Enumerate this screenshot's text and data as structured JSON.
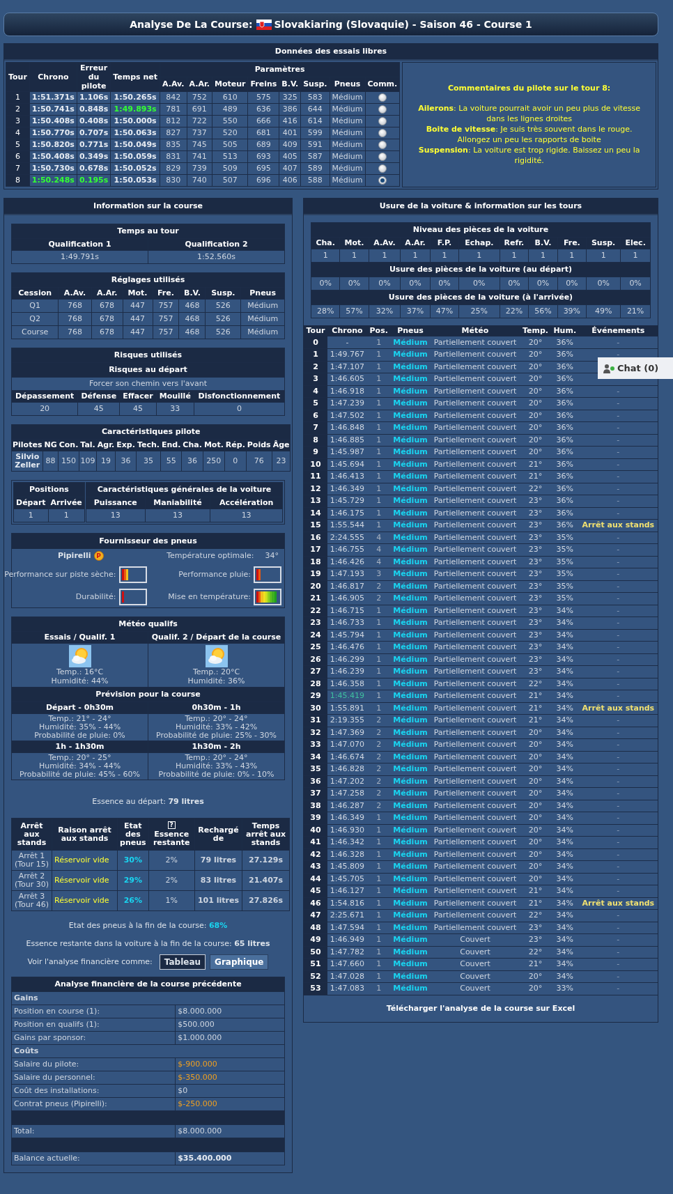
{
  "title": {
    "prefix": "Analyse De La Course:",
    "text": "Slovakiaring (Slovaquie) - Saison 46 - Course 1"
  },
  "chat": {
    "label": "Chat (0)"
  },
  "practice": {
    "title": "Données des essais libres",
    "columns": [
      "Tour",
      "Chrono",
      "Erreur du pilote",
      "Temps net"
    ],
    "params_header": "Paramètres",
    "params": [
      "A.Av.",
      "A.Ar.",
      "Moteur",
      "Freins",
      "B.V.",
      "Susp.",
      "Pneus",
      "Comm."
    ],
    "rows": [
      {
        "cells": [
          "1",
          "1:51.371s",
          "1.106s",
          "1:50.265s",
          "842",
          "752",
          "610",
          "575",
          "325",
          "583",
          "Médium"
        ],
        "chrono_best": false,
        "error_best": false,
        "net_best": false,
        "selected": false
      },
      {
        "cells": [
          "2",
          "1:50.741s",
          "0.848s",
          "1:49.893s",
          "781",
          "691",
          "489",
          "636",
          "386",
          "644",
          "Médium"
        ],
        "chrono_best": false,
        "error_best": false,
        "net_best": true,
        "selected": false
      },
      {
        "cells": [
          "3",
          "1:50.408s",
          "0.408s",
          "1:50.000s",
          "812",
          "722",
          "550",
          "666",
          "416",
          "614",
          "Médium"
        ],
        "chrono_best": false,
        "error_best": false,
        "net_best": false,
        "selected": false
      },
      {
        "cells": [
          "4",
          "1:50.770s",
          "0.707s",
          "1:50.063s",
          "827",
          "737",
          "520",
          "681",
          "401",
          "599",
          "Médium"
        ],
        "chrono_best": false,
        "error_best": false,
        "net_best": false,
        "selected": false
      },
      {
        "cells": [
          "5",
          "1:50.820s",
          "0.771s",
          "1:50.049s",
          "835",
          "745",
          "505",
          "689",
          "409",
          "591",
          "Médium"
        ],
        "chrono_best": false,
        "error_best": false,
        "net_best": false,
        "selected": false
      },
      {
        "cells": [
          "6",
          "1:50.408s",
          "0.349s",
          "1:50.059s",
          "831",
          "741",
          "513",
          "693",
          "405",
          "587",
          "Médium"
        ],
        "chrono_best": false,
        "error_best": false,
        "net_best": false,
        "selected": false
      },
      {
        "cells": [
          "7",
          "1:50.730s",
          "0.678s",
          "1:50.052s",
          "829",
          "739",
          "509",
          "695",
          "407",
          "589",
          "Médium"
        ],
        "chrono_best": false,
        "error_best": false,
        "net_best": false,
        "selected": false
      },
      {
        "cells": [
          "8",
          "1:50.248s",
          "0.195s",
          "1:50.053s",
          "830",
          "740",
          "507",
          "696",
          "406",
          "588",
          "Médium"
        ],
        "chrono_best": true,
        "error_best": true,
        "net_best": false,
        "selected": true
      }
    ],
    "comment": {
      "title": "Commentaires du pilote sur le tour 8:",
      "lines": [
        "**Ailerons**: La voiture pourrait avoir un peu plus de vitesse dans les lignes droites",
        "**Boite de vitesse**: Je suis très souvent dans le rouge. Allongez un peu les rapports de boite",
        "**Suspension**: La voiture est trop rigide. Baissez un peu la rigidité."
      ]
    }
  },
  "info": {
    "title": "Information sur la course",
    "laptimes": {
      "title": "Temps au tour",
      "columns": [
        "Qualification 1",
        "Qualification 2"
      ],
      "values": [
        "1:49.791s",
        "1:52.560s"
      ]
    },
    "setup": {
      "title": "Réglages utilisés",
      "columns": [
        "Cession",
        "A.Av.",
        "A.Ar.",
        "Mot.",
        "Fre.",
        "B.V.",
        "Susp.",
        "Pneus"
      ],
      "rows": [
        [
          "Q1",
          "768",
          "678",
          "447",
          "757",
          "468",
          "526",
          "Médium"
        ],
        [
          "Q2",
          "768",
          "678",
          "447",
          "757",
          "468",
          "526",
          "Médium"
        ],
        [
          "Course",
          "768",
          "678",
          "447",
          "757",
          "468",
          "526",
          "Médium"
        ]
      ]
    },
    "risks": {
      "title": "Risques utilisés",
      "subtitle": "Risques au départ",
      "start": "Forcer son chemin vers l'avant",
      "columns": [
        "Dépassement",
        "Défense",
        "Effacer",
        "Mouillé",
        "Disfonctionnement"
      ],
      "values": [
        "20",
        "45",
        "45",
        "33",
        "0"
      ]
    },
    "driver": {
      "title": "Caractéristiques pilote",
      "columns": [
        "Pilotes",
        "NG",
        "Con.",
        "Tal.",
        "Agr.",
        "Exp.",
        "Tech.",
        "End.",
        "Cha.",
        "Mot.",
        "Rép.",
        "Poids",
        "Âge"
      ],
      "name": "Silvio Zeller",
      "values": [
        "88",
        "150",
        "109",
        "19",
        "36",
        "35",
        "55",
        "36",
        "250",
        "0",
        "76",
        "23"
      ]
    },
    "positions": {
      "title": "Positions",
      "columns": [
        "Départ",
        "Arrivée"
      ],
      "values": [
        "1",
        "1"
      ]
    },
    "car": {
      "title": "Caractéristiques générales de la voiture",
      "columns": [
        "Puissance",
        "Maniabilité",
        "Accélération"
      ],
      "values": [
        "13",
        "13",
        "13"
      ]
    },
    "tyres": {
      "title": "Fournisseur des pneus",
      "name": "Pipirelli",
      "badge": "P",
      "optimal_label": "Température optimale:",
      "optimal_value": "34°",
      "meters": [
        {
          "label": "Performance sur piste sèche:",
          "level": 0.3
        },
        {
          "label": "Performance pluie:",
          "level": 0.2
        },
        {
          "label": "Durabilité:",
          "level": 0.1
        },
        {
          "label": "Mise en température:",
          "level": 0.9
        }
      ]
    },
    "weather": {
      "title": "Météo qualifs",
      "sessions": [
        {
          "title": "Essais / Qualif. 1",
          "temp": "Temp.: 16°C",
          "humidity": "Humidité: 44%"
        },
        {
          "title": "Qualif. 2 / Départ de la course",
          "temp": "Temp.: 20°C",
          "humidity": "Humidité: 36%"
        }
      ],
      "forecast_title": "Prévision pour la course",
      "forecast": [
        {
          "title": "Départ - 0h30m",
          "lines": [
            "Temp.: 21° - 24°",
            "Humidité: 35% - 44%",
            "Probabilité de pluie: 0%"
          ]
        },
        {
          "title": "0h30m - 1h",
          "lines": [
            "Temp.: 20° - 24°",
            "Humidité: 33% - 42%",
            "Probabilité de pluie: 25% - 30%"
          ]
        },
        {
          "title": "1h - 1h30m",
          "lines": [
            "Temp.: 20° - 25°",
            "Humidité: 34% - 44%",
            "Probabilité de pluie: 45% - 60%"
          ]
        },
        {
          "title": "1h30m - 2h",
          "lines": [
            "Temp.: 20° - 24°",
            "Humidité: 33% - 43%",
            "Probabilité de pluie: 0% - 10%"
          ]
        }
      ]
    },
    "fuel_start": "Essence au départ: **79 litres**",
    "pits": {
      "columns": [
        {
          "label": "Arrêt aux stands"
        },
        {
          "label": "Raison arrêt aux stands"
        },
        {
          "label": "Etat des pneus"
        },
        {
          "label": "Essence restante",
          "help": "?"
        },
        {
          "label": "Rechargé de"
        },
        {
          "label": "Temps arrêt aux stands"
        }
      ],
      "rows": [
        [
          "Arrêt 1 (Tour 15)",
          "Réservoir vide",
          "30%",
          "2%",
          "79 litres",
          "27.129s"
        ],
        [
          "Arrêt 2 (Tour 30)",
          "Réservoir vide",
          "29%",
          "2%",
          "83 litres",
          "21.407s"
        ],
        [
          "Arrêt 3 (Tour 46)",
          "Réservoir vide",
          "26%",
          "1%",
          "101 litres",
          "27.826s"
        ]
      ]
    },
    "tyres_end": {
      "label": "Etat des pneus à la fin de la course:",
      "value": "68%"
    },
    "fuel_end": "Essence restante dans la voiture à la fin de la course: **65 litres**",
    "view": {
      "label": "Voir l'analyse financière comme:",
      "options": [
        {
          "label": "Tableau",
          "selected": true
        },
        {
          "label": "Graphique",
          "selected": false
        }
      ]
    },
    "finance": {
      "title": "Analyse financière de la course précédente",
      "rows": [
        {
          "kind": "section",
          "label": "Gains"
        },
        {
          "kind": "item",
          "label": "Position en course (1):",
          "value": "$8.000.000"
        },
        {
          "kind": "item",
          "label": "Position en qualifs (1):",
          "value": "$500.000"
        },
        {
          "kind": "item",
          "label": "Gains par sponsor:",
          "value": "$1.000.000"
        },
        {
          "kind": "section",
          "label": "Coûts"
        },
        {
          "kind": "cost",
          "label": "Salaire du pilote:",
          "value": "$-900.000"
        },
        {
          "kind": "cost",
          "label": "Salaire du personnel:",
          "value": "$-350.000"
        },
        {
          "kind": "item",
          "label": "Coût des installations:",
          "value": "$0"
        },
        {
          "kind": "cost",
          "label": "Contrat pneus (Pipirelli):",
          "value": "$-250.000"
        },
        {
          "kind": "blank"
        },
        {
          "kind": "item",
          "label": "Total:",
          "value": "$8.000.000"
        },
        {
          "kind": "blank"
        },
        {
          "kind": "balance",
          "label": "Balance actuelle:",
          "value": "$35.400.000"
        }
      ]
    }
  },
  "wear": {
    "title": "Usure de la voiture & information sur les tours",
    "parts_title": "Niveau des pièces de la voiture",
    "parts": [
      "Cha.",
      "Mot.",
      "A.Av.",
      "A.Ar.",
      "F.P.",
      "Echap.",
      "Refr.",
      "B.V.",
      "Fre.",
      "Susp.",
      "Elec."
    ],
    "levels": [
      "1",
      "1",
      "1",
      "1",
      "1",
      "1",
      "1",
      "1",
      "1",
      "1",
      "1"
    ],
    "start_title": "Usure des pièces de la voiture (au départ)",
    "start": [
      "0%",
      "0%",
      "0%",
      "0%",
      "0%",
      "0%",
      "0%",
      "0%",
      "0%",
      "0%",
      "0%"
    ],
    "end_title": "Usure des pièces de la voiture (à l'arrivée)",
    "end": [
      "28%",
      "57%",
      "32%",
      "37%",
      "47%",
      "25%",
      "22%",
      "56%",
      "39%",
      "49%",
      "21%"
    ],
    "lap_columns": [
      "Tour",
      "Chrono",
      "Pos.",
      "Pneus",
      "Météo",
      "Temp.",
      "Hum.",
      "Événements"
    ],
    "laps": [
      {
        "cells": [
          "0",
          "-",
          "1",
          "Médium",
          "Partiellement couvert",
          "20°",
          "36%",
          "-"
        ],
        "best": false,
        "pit": false
      },
      {
        "cells": [
          "1",
          "1:49.767",
          "1",
          "Médium",
          "Partiellement couvert",
          "20°",
          "36%",
          "-"
        ],
        "best": false,
        "pit": false
      },
      {
        "cells": [
          "2",
          "1:47.107",
          "1",
          "Médium",
          "Partiellement couvert",
          "20°",
          "36%"
        ],
        "best": false
      },
      {
        "cells": [
          "3",
          "1:46.605",
          "1",
          "Médium",
          "Partiellement couvert",
          "20°",
          "36%"
        ],
        "best": false
      },
      {
        "cells": [
          "4",
          "1:46.918",
          "1",
          "Médium",
          "Partiellement couvert",
          "20°",
          "36%",
          "-"
        ],
        "best": false,
        "pit": false
      },
      {
        "cells": [
          "5",
          "1:47.239",
          "1",
          "Médium",
          "Partiellement couvert",
          "20°",
          "36%",
          "-"
        ],
        "best": false,
        "pit": false
      },
      {
        "cells": [
          "6",
          "1:47.502",
          "1",
          "Médium",
          "Partiellement couvert",
          "20°",
          "36%",
          "-"
        ],
        "best": false,
        "pit": false
      },
      {
        "cells": [
          "7",
          "1:46.848",
          "1",
          "Médium",
          "Partiellement couvert",
          "20°",
          "36%",
          "-"
        ],
        "best": false,
        "pit": false
      },
      {
        "cells": [
          "8",
          "1:46.885",
          "1",
          "Médium",
          "Partiellement couvert",
          "20°",
          "36%",
          "-"
        ],
        "best": false,
        "pit": false
      },
      {
        "cells": [
          "9",
          "1:45.987",
          "1",
          "Médium",
          "Partiellement couvert",
          "20°",
          "36%",
          "-"
        ],
        "best": false,
        "pit": false
      },
      {
        "cells": [
          "10",
          "1:45.694",
          "1",
          "Médium",
          "Partiellement couvert",
          "21°",
          "36%",
          "-"
        ],
        "best": false,
        "pit": false
      },
      {
        "cells": [
          "11",
          "1:46.413",
          "1",
          "Médium",
          "Partiellement couvert",
          "21°",
          "36%",
          "-"
        ],
        "best": false,
        "pit": false
      },
      {
        "cells": [
          "12",
          "1:46.349",
          "1",
          "Médium",
          "Partiellement couvert",
          "22°",
          "36%",
          "-"
        ],
        "best": false,
        "pit": false
      },
      {
        "cells": [
          "13",
          "1:45.729",
          "1",
          "Médium",
          "Partiellement couvert",
          "23°",
          "36%",
          "-"
        ],
        "best": false,
        "pit": false
      },
      {
        "cells": [
          "14",
          "1:46.175",
          "1",
          "Médium",
          "Partiellement couvert",
          "23°",
          "36%",
          "-"
        ],
        "best": false,
        "pit": false
      },
      {
        "cells": [
          "15",
          "1:55.544",
          "1",
          "Médium",
          "Partiellement couvert",
          "23°",
          "36%",
          "Arrêt aux stands"
        ],
        "best": false,
        "pit": true
      },
      {
        "cells": [
          "16",
          "2:24.555",
          "4",
          "Médium",
          "Partiellement couvert",
          "23°",
          "35%",
          "-"
        ],
        "best": false,
        "pit": false
      },
      {
        "cells": [
          "17",
          "1:46.755",
          "4",
          "Médium",
          "Partiellement couvert",
          "23°",
          "35%",
          "-"
        ],
        "best": false,
        "pit": false
      },
      {
        "cells": [
          "18",
          "1:46.426",
          "4",
          "Médium",
          "Partiellement couvert",
          "23°",
          "35%",
          "-"
        ],
        "best": false,
        "pit": false
      },
      {
        "cells": [
          "19",
          "1:47.193",
          "3",
          "Médium",
          "Partiellement couvert",
          "23°",
          "35%",
          "-"
        ],
        "best": false,
        "pit": false
      },
      {
        "cells": [
          "20",
          "1:46.817",
          "2",
          "Médium",
          "Partiellement couvert",
          "23°",
          "35%",
          "-"
        ],
        "best": false,
        "pit": false
      },
      {
        "cells": [
          "21",
          "1:46.905",
          "2",
          "Médium",
          "Partiellement couvert",
          "23°",
          "35%",
          "-"
        ],
        "best": false,
        "pit": false
      },
      {
        "cells": [
          "22",
          "1:46.715",
          "1",
          "Médium",
          "Partiellement couvert",
          "23°",
          "34%",
          "-"
        ],
        "best": false,
        "pit": false
      },
      {
        "cells": [
          "23",
          "1:46.733",
          "1",
          "Médium",
          "Partiellement couvert",
          "23°",
          "34%",
          "-"
        ],
        "best": false,
        "pit": false
      },
      {
        "cells": [
          "24",
          "1:45.794",
          "1",
          "Médium",
          "Partiellement couvert",
          "23°",
          "34%",
          "-"
        ],
        "best": false,
        "pit": false
      },
      {
        "cells": [
          "25",
          "1:46.476",
          "1",
          "Médium",
          "Partiellement couvert",
          "23°",
          "34%",
          "-"
        ],
        "best": false,
        "pit": false
      },
      {
        "cells": [
          "26",
          "1:46.299",
          "1",
          "Médium",
          "Partiellement couvert",
          "23°",
          "34%",
          "-"
        ],
        "best": false,
        "pit": false
      },
      {
        "cells": [
          "27",
          "1:46.239",
          "1",
          "Médium",
          "Partiellement couvert",
          "23°",
          "34%",
          "-"
        ],
        "best": false,
        "pit": false
      },
      {
        "cells": [
          "28",
          "1:46.358",
          "1",
          "Médium",
          "Partiellement couvert",
          "22°",
          "34%",
          "-"
        ],
        "best": false,
        "pit": false
      },
      {
        "cells": [
          "29",
          "1:45.419",
          "1",
          "Médium",
          "Partiellement couvert",
          "21°",
          "34%",
          "-"
        ],
        "best": true,
        "pit": false
      },
      {
        "cells": [
          "30",
          "1:55.891",
          "1",
          "Médium",
          "Partiellement couvert",
          "21°",
          "34%",
          "Arrêt aux stands"
        ],
        "best": false,
        "pit": true
      },
      {
        "cells": [
          "31",
          "2:19.355",
          "2",
          "Médium",
          "Partiellement couvert",
          "21°",
          "34%",
          "-"
        ],
        "best": false,
        "pit": false
      },
      {
        "cells": [
          "32",
          "1:47.369",
          "2",
          "Médium",
          "Partiellement couvert",
          "20°",
          "34%",
          "-"
        ],
        "best": false,
        "pit": false
      },
      {
        "cells": [
          "33",
          "1:47.070",
          "2",
          "Médium",
          "Partiellement couvert",
          "20°",
          "34%",
          "-"
        ],
        "best": false,
        "pit": false
      },
      {
        "cells": [
          "34",
          "1:46.674",
          "2",
          "Médium",
          "Partiellement couvert",
          "20°",
          "34%",
          "-"
        ],
        "best": false,
        "pit": false
      },
      {
        "cells": [
          "35",
          "1:46.828",
          "2",
          "Médium",
          "Partiellement couvert",
          "20°",
          "34%",
          "-"
        ],
        "best": false,
        "pit": false
      },
      {
        "cells": [
          "36",
          "1:47.202",
          "2",
          "Médium",
          "Partiellement couvert",
          "20°",
          "34%",
          "-"
        ],
        "best": false,
        "pit": false
      },
      {
        "cells": [
          "37",
          "1:47.258",
          "2",
          "Médium",
          "Partiellement couvert",
          "20°",
          "34%",
          "-"
        ],
        "best": false,
        "pit": false
      },
      {
        "cells": [
          "38",
          "1:46.287",
          "2",
          "Médium",
          "Partiellement couvert",
          "20°",
          "34%",
          "-"
        ],
        "best": false,
        "pit": false
      },
      {
        "cells": [
          "39",
          "1:46.349",
          "1",
          "Médium",
          "Partiellement couvert",
          "20°",
          "34%",
          "-"
        ],
        "best": false,
        "pit": false
      },
      {
        "cells": [
          "40",
          "1:46.930",
          "1",
          "Médium",
          "Partiellement couvert",
          "20°",
          "34%",
          "-"
        ],
        "best": false,
        "pit": false
      },
      {
        "cells": [
          "41",
          "1:46.342",
          "1",
          "Médium",
          "Partiellement couvert",
          "20°",
          "34%",
          "-"
        ],
        "best": false,
        "pit": false
      },
      {
        "cells": [
          "42",
          "1:46.328",
          "1",
          "Médium",
          "Partiellement couvert",
          "20°",
          "34%",
          "-"
        ],
        "best": false,
        "pit": false
      },
      {
        "cells": [
          "43",
          "1:45.809",
          "1",
          "Médium",
          "Partiellement couvert",
          "20°",
          "34%",
          "-"
        ],
        "best": false,
        "pit": false
      },
      {
        "cells": [
          "44",
          "1:45.705",
          "1",
          "Médium",
          "Partiellement couvert",
          "20°",
          "34%",
          "-"
        ],
        "best": false,
        "pit": false
      },
      {
        "cells": [
          "45",
          "1:46.127",
          "1",
          "Médium",
          "Partiellement couvert",
          "21°",
          "34%",
          "-"
        ],
        "best": false,
        "pit": false
      },
      {
        "cells": [
          "46",
          "1:54.816",
          "1",
          "Médium",
          "Partiellement couvert",
          "21°",
          "34%",
          "Arrêt aux stands"
        ],
        "best": false,
        "pit": true
      },
      {
        "cells": [
          "47",
          "2:25.671",
          "1",
          "Médium",
          "Partiellement couvert",
          "22°",
          "34%",
          "-"
        ],
        "best": false,
        "pit": false
      },
      {
        "cells": [
          "48",
          "1:47.594",
          "1",
          "Médium",
          "Partiellement couvert",
          "23°",
          "34%",
          "-"
        ],
        "best": false,
        "pit": false
      },
      {
        "cells": [
          "49",
          "1:46.949",
          "1",
          "Médium",
          "Couvert",
          "23°",
          "34%",
          "-"
        ],
        "best": false,
        "pit": false
      },
      {
        "cells": [
          "50",
          "1:47.782",
          "1",
          "Médium",
          "Couvert",
          "22°",
          "34%",
          "-"
        ],
        "best": false,
        "pit": false
      },
      {
        "cells": [
          "51",
          "1:47.660",
          "1",
          "Médium",
          "Couvert",
          "21°",
          "34%",
          "-"
        ],
        "best": false,
        "pit": false
      },
      {
        "cells": [
          "52",
          "1:47.028",
          "1",
          "Médium",
          "Couvert",
          "20°",
          "34%",
          "-"
        ],
        "best": false,
        "pit": false
      },
      {
        "cells": [
          "53",
          "1:47.083",
          "1",
          "Médium",
          "Couvert",
          "20°",
          "33%",
          "-"
        ],
        "best": false,
        "pit": false
      }
    ],
    "download": "Télécharger l'analyse de la course sur Excel"
  }
}
